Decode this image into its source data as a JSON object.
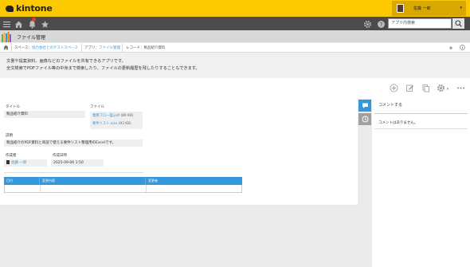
{
  "header": {
    "logo_text": "kintone",
    "user_name": "佐藤 一郎",
    "search_placeholder": "アプリ内検索",
    "notification_badge_color": "#e0402c",
    "accent_color": "#fcc800"
  },
  "app": {
    "title": "ファイル管理"
  },
  "breadcrumb": {
    "space_prefix": "スペース：",
    "space_name": "協力会社とのゲストスペース",
    "app_prefix": "アプリ：",
    "app_name": "ファイル管理",
    "record_prefix": "レコード：",
    "record_name": "製品紹介資料"
  },
  "description": {
    "line1": "文書や提案資料、画像などのファイルを共有できるアプリです。",
    "line2": "全文検索でPDFファイル等の中身まで検索したり、ファイルの更新履歴を残したりすることもできます。"
  },
  "toolbar": {
    "icons": [
      "plus-icon",
      "edit-icon",
      "copy-icon",
      "gear-icon",
      "more-icon"
    ]
  },
  "record": {
    "title_label": "タイトル",
    "title_value": "製品紹介資料",
    "file_label": "ファイル",
    "files": [
      {
        "name": "業務フロー図.pdf",
        "size": "(89 KB)"
      },
      {
        "name": "要件リスト.xlsx",
        "size": "(93 KB)"
      }
    ],
    "desc_label": "説明",
    "desc_value": "製品紹介のPDF資料と商談で使える要件リスト整理用のExcelです。",
    "creator_label": "作成者",
    "creator_value": "佐藤 一郎",
    "created_label": "作成日時",
    "created_value": "2025-09-06 1:50",
    "history_headers": [
      "日付",
      "変更内容",
      "変更者"
    ]
  },
  "sidebar": {
    "comment_tab_color": "#3498db",
    "history_tab_color": "#a0a0a0"
  },
  "comments": {
    "title": "コメントする",
    "empty_text": "コメントはありません。"
  }
}
